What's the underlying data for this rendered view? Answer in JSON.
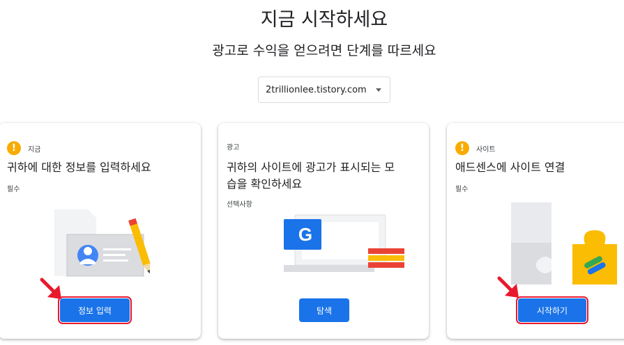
{
  "header": {
    "title": "지금 시작하세요",
    "subtitle": "광고로 수익을 얻으려면 단계를 따르세요"
  },
  "site_selector": {
    "value": "2trillionlee.tistory.com"
  },
  "cards": [
    {
      "status_label": "지금",
      "title": "귀하에 대한 정보를 입력하세요",
      "note": "필수",
      "button_label": "정보 입력"
    },
    {
      "status_label": "광고",
      "title": "귀하의 사이트에 광고가 표시되는 모습을 확인하세요",
      "note": "선택사항",
      "button_label": "탐색",
      "illustration_glyph": "G"
    },
    {
      "status_label": "사이트",
      "title": "애드센스에 사이트 연결",
      "note": "필수",
      "button_label": "시작하기"
    }
  ],
  "icons": {
    "warning": "!"
  },
  "colors": {
    "primary_button": "#1a73e8",
    "warning": "#f9ab00",
    "annotation_red": "#e8192c"
  }
}
